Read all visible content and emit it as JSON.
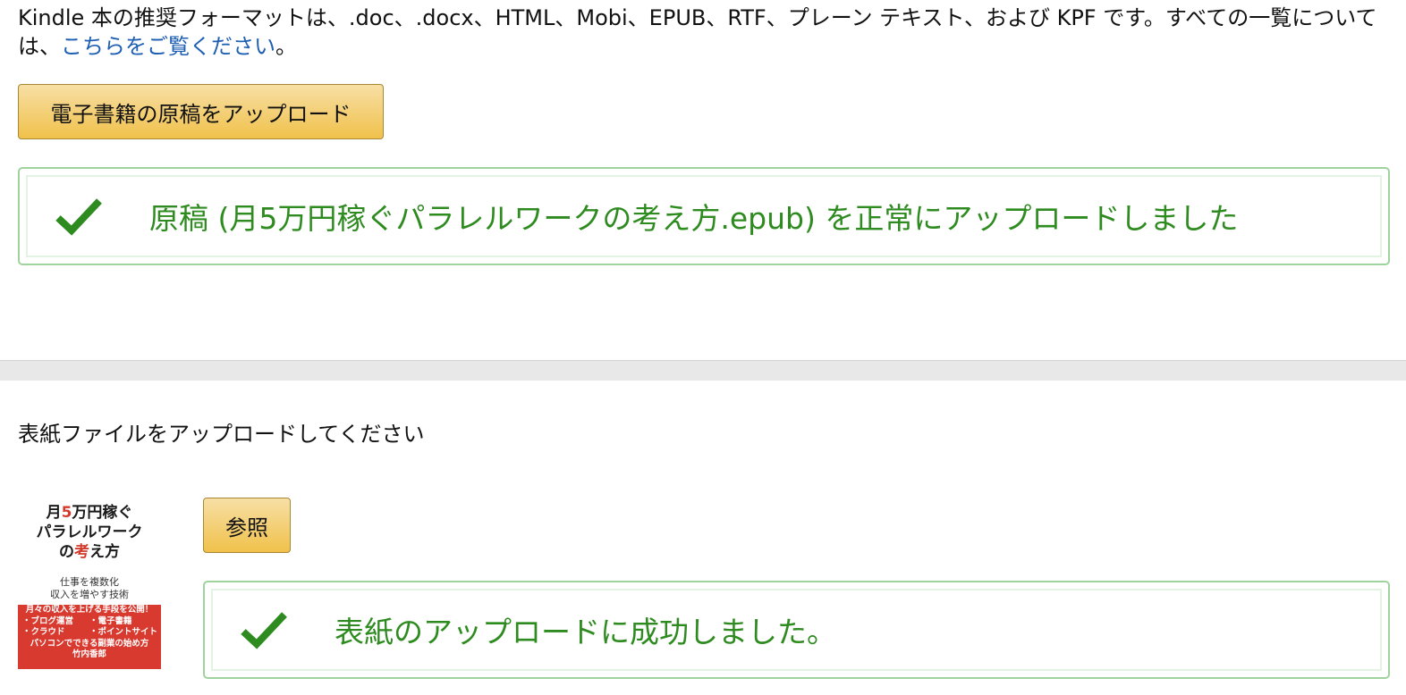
{
  "intro": {
    "text": "Kindle 本の推奨フォーマットは、.doc、.docx、HTML、Mobi、EPUB、RTF、プレーン テキスト、および KPF です。すべての一覧については、",
    "link_text": "こちらをご覧ください",
    "suffix": "。"
  },
  "manuscript": {
    "upload_button_label": "電子書籍の原稿をアップロード",
    "success_message": "原稿 (月5万円稼ぐパラレルワークの考え方.epub) を正常にアップロードしました"
  },
  "cover": {
    "heading": "表紙ファイルをアップロードしてください",
    "browse_button_label": "参照",
    "success_message": "表紙のアップロードに成功しました。",
    "thumbnail": {
      "title_line1_a": "月",
      "title_line1_b": "5",
      "title_line1_c": "万円稼ぐ",
      "title_line2": "パラレルワーク",
      "title_line3_a": "の",
      "title_line3_b": "考",
      "title_line3_c": "え方",
      "subtitle_line1": "仕事を複数化",
      "subtitle_line2": "収入を増やす技術",
      "band_line1": "月々の収入を上げる手段を公開！",
      "band_item1": "・ブログ運営",
      "band_item2": "・電子書籍",
      "band_item3": "・クラウド",
      "band_item4": "・ポイントサイト",
      "band_line3": "パソコンでできる副業の始め方",
      "author": "竹内香郎"
    }
  },
  "colors": {
    "success_green": "#2e8b1f",
    "link_blue": "#1e5fb3",
    "button_gold": "#f0c14b",
    "alert_border": "#9ed39e",
    "cover_red": "#d93a2f"
  },
  "icons": {
    "success": "check-icon"
  }
}
